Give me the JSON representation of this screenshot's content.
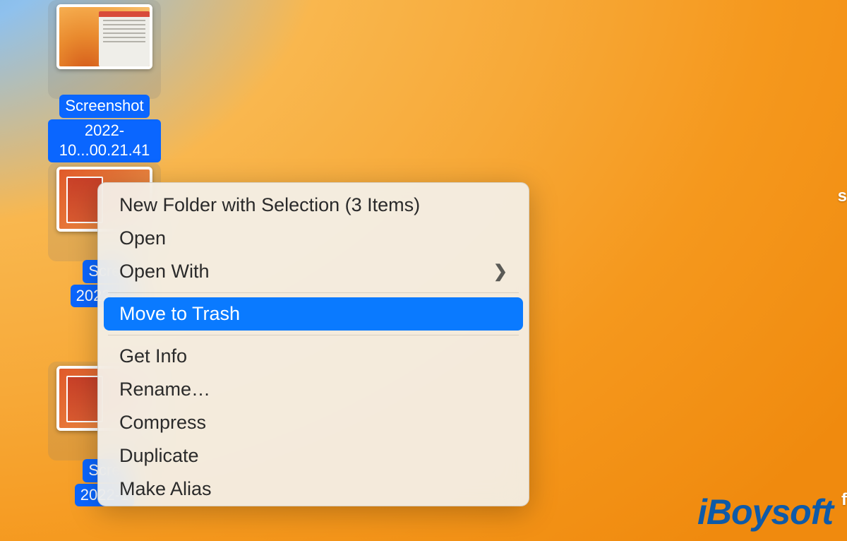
{
  "desktop": {
    "files": [
      {
        "label_line1": "Screenshot",
        "label_line2": "2022-10...00.21.41"
      },
      {
        "label_line1": "Scre",
        "label_line2": "2022-10"
      },
      {
        "label_line1": "Scre",
        "label_line2": "2022-1"
      }
    ]
  },
  "context_menu": {
    "items": [
      {
        "label": "New Folder with Selection (3 Items)",
        "submenu": false,
        "highlighted": false
      },
      {
        "label": "Open",
        "submenu": false,
        "highlighted": false
      },
      {
        "label": "Open With",
        "submenu": true,
        "highlighted": false
      },
      {
        "separator": true
      },
      {
        "label": "Move to Trash",
        "submenu": false,
        "highlighted": true
      },
      {
        "separator": true
      },
      {
        "label": "Get Info",
        "submenu": false,
        "highlighted": false
      },
      {
        "label": "Rename…",
        "submenu": false,
        "highlighted": false
      },
      {
        "label": "Compress",
        "submenu": false,
        "highlighted": false
      },
      {
        "label": "Duplicate",
        "submenu": false,
        "highlighted": false
      },
      {
        "label": "Make Alias",
        "submenu": false,
        "highlighted": false
      }
    ]
  },
  "watermark": "iBoysoft",
  "edge": {
    "s": "s",
    "f": "f"
  },
  "colors": {
    "selection_blue": "#0a66ff",
    "menu_highlight": "#0a7aff",
    "menu_bg": "#f3f1eb"
  }
}
